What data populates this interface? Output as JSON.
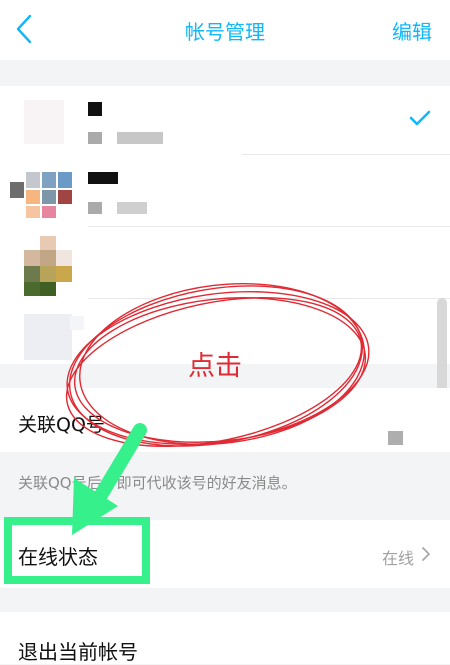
{
  "header": {
    "title": "帐号管理",
    "edit_label": "编辑",
    "back_icon": "chevron-left-icon",
    "accent_color": "#12b7f5"
  },
  "accounts": {
    "selected_index": 0,
    "check_icon": "checkmark-icon",
    "avatars": "pixelated",
    "count": 4
  },
  "linked": {
    "label": "关联QQ号",
    "hint": "关联QQ号后，即可代收该号的好友消息。"
  },
  "status": {
    "label": "在线状态",
    "value": "在线",
    "chevron_icon": "chevron-right-icon"
  },
  "logout": {
    "label": "退出当前帐号"
  },
  "annotation": {
    "text": "点击",
    "text_color": "#e02a34",
    "highlight_color": "#35f08b"
  }
}
